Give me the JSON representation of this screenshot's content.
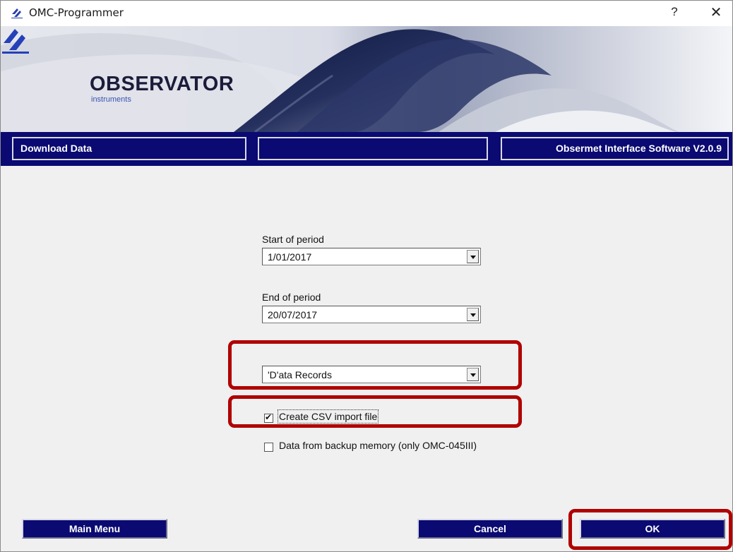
{
  "window": {
    "title": "OMC-Programmer",
    "help_label": "?",
    "close_label": "✕"
  },
  "banner": {
    "brand": "OBSERVATOR",
    "brand_sub": "instruments"
  },
  "navbar": {
    "left": "Download Data",
    "middle": "",
    "right": "Obsermet Interface Software V2.0.9"
  },
  "form": {
    "start_label": "Start of period",
    "start_value": "1/01/2017",
    "end_label": "End of period",
    "end_value": "20/07/2017",
    "record_type_value": "'D'ata Records",
    "csv_label": "Create CSV import file",
    "csv_checked": true,
    "backup_label": "Data from backup memory (only OMC-045III)",
    "backup_checked": false
  },
  "buttons": {
    "main_menu": "Main Menu",
    "cancel": "Cancel",
    "ok": "OK"
  },
  "colors": {
    "navy": "#0a0a72",
    "highlight": "#b00000"
  }
}
